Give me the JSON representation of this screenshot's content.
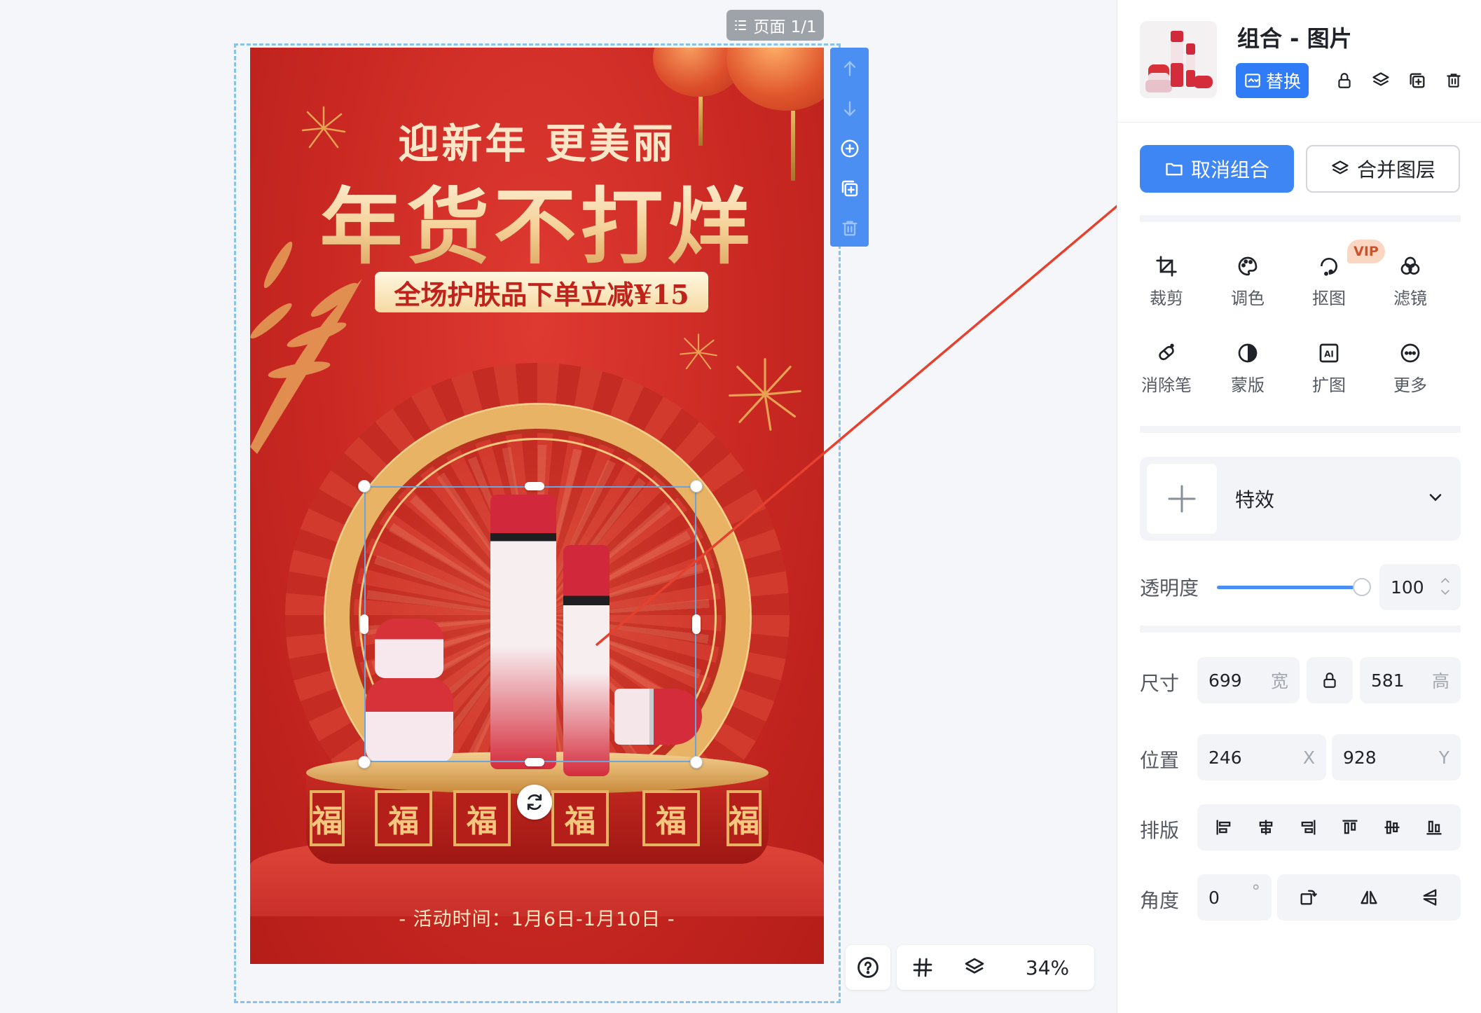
{
  "canvas": {
    "page_indicator": "页面 1/1",
    "zoom": "34%",
    "poster": {
      "headline": "迎新年 更美丽",
      "title": "年货不打烊",
      "promo": "全场护肤品下单立减¥15",
      "fu_char": "福",
      "date": "- 活动时间：1月6日-1月10日 -",
      "colors": {
        "background": "#c92822",
        "gold": "#e8b364"
      }
    },
    "layer_toolbar": [
      "arrow-up-icon",
      "arrow-down-icon",
      "add-circle-icon",
      "duplicate-icon",
      "trash-icon"
    ],
    "bottom_bar": [
      "help-icon",
      "grid-icon",
      "layers-icon"
    ]
  },
  "panel": {
    "title": "组合 - 图片",
    "replace_label": "替换",
    "head_icons": [
      "lock-icon",
      "layers-icon",
      "duplicate-icon",
      "trash-icon"
    ],
    "ungroup_label": "取消组合",
    "merge_label": "合并图层",
    "tools": [
      {
        "label": "裁剪",
        "icon": "crop-icon"
      },
      {
        "label": "调色",
        "icon": "palette-icon"
      },
      {
        "label": "抠图",
        "icon": "cutout-icon"
      },
      {
        "label": "滤镜",
        "icon": "filter-icon"
      },
      {
        "label": "消除笔",
        "icon": "eraser-icon"
      },
      {
        "label": "蒙版",
        "icon": "mask-icon"
      },
      {
        "label": "扩图",
        "icon": "ai-expand-icon"
      },
      {
        "label": "更多",
        "icon": "more-icon"
      }
    ],
    "vip_badge": "VIP",
    "effect_label": "特效",
    "opacity_label": "透明度",
    "opacity_value": "100",
    "opacity_fraction": 1.0,
    "size_label": "尺寸",
    "width_value": "699",
    "width_unit": "宽",
    "height_value": "581",
    "height_unit": "高",
    "position_label": "位置",
    "x_value": "246",
    "x_unit": "X",
    "y_value": "928",
    "y_unit": "Y",
    "layout_label": "排版",
    "align_icons": [
      "align-left-icon",
      "align-center-h-icon",
      "align-right-icon",
      "align-top-icon",
      "align-center-v-icon",
      "align-bottom-icon"
    ],
    "angle_label": "角度",
    "angle_value": "0",
    "angle_unit": "°",
    "angle_tools": [
      "rotate-icon",
      "flip-horizontal-icon",
      "flip-vertical-icon"
    ],
    "accent_color": "#2f7cf6"
  }
}
